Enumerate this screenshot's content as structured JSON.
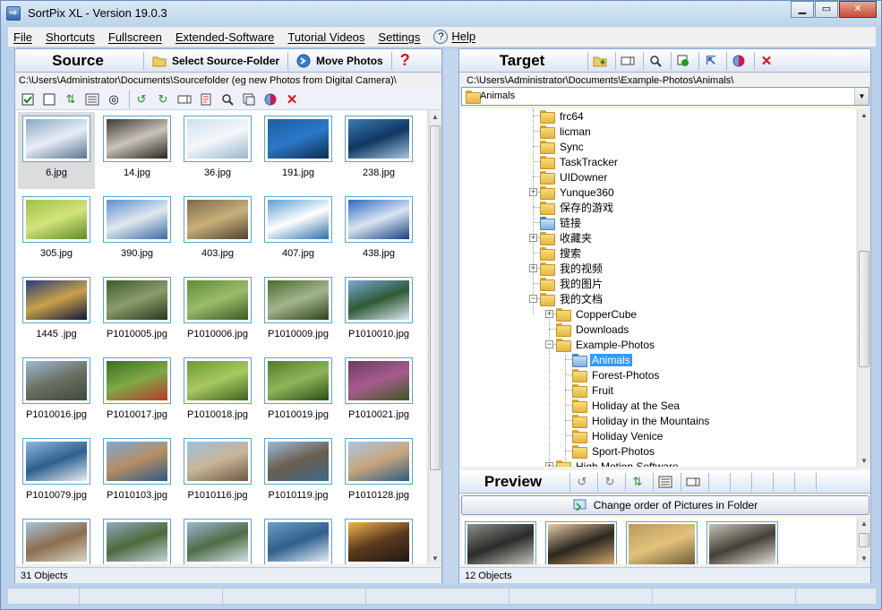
{
  "window": {
    "title": "SortPix XL - Version 19.0.3",
    "min": "▁",
    "max": "▭",
    "close": "✕"
  },
  "menu": [
    {
      "label": "File"
    },
    {
      "label": "Shortcuts"
    },
    {
      "label": "Fullscreen"
    },
    {
      "label": "Extended-Software"
    },
    {
      "label": "Tutorial Videos"
    },
    {
      "label": "Settings"
    },
    {
      "label": "Help",
      "icon": "help-icon"
    }
  ],
  "source": {
    "title": "Source",
    "select_folder": "Select Source-Folder",
    "move_photos": "Move Photos",
    "help_glyph": "?",
    "path": "C:\\Users\\Administrator\\Documents\\Sourcefolder (eg new Photos from Digital Camera)\\",
    "toolbar_icons": [
      "check-all-icon",
      "uncheck-all-icon",
      "sort-icon",
      "list-view-icon",
      "rotate-sound-icon",
      "rotate-left-icon",
      "rotate-right-icon",
      "rename-icon",
      "properties-icon",
      "search-icon",
      "copy-icon",
      "color-icon",
      "delete-icon"
    ],
    "thumbs": [
      {
        "name": "6.jpg",
        "colors": [
          "#8aa6c4",
          "#e9eef5",
          "#5a7390"
        ]
      },
      {
        "name": "14.jpg",
        "colors": [
          "#3d3a33",
          "#c9c3b8",
          "#262521"
        ]
      },
      {
        "name": "36.jpg",
        "colors": [
          "#cfe0ee",
          "#f5f7fa",
          "#9bb5cc"
        ]
      },
      {
        "name": "191.jpg",
        "colors": [
          "#1c5fa3",
          "#2b78c9",
          "#0d2c4f"
        ]
      },
      {
        "name": "238.jpg",
        "colors": [
          "#3c7ab0",
          "#0f3763",
          "#a7c6e0"
        ]
      },
      {
        "name": "305.jpg",
        "colors": [
          "#9cc24a",
          "#d3e47a",
          "#5f8a24"
        ]
      },
      {
        "name": "390.jpg",
        "colors": [
          "#5b8fcf",
          "#e0e8ef",
          "#3a6aa0"
        ]
      },
      {
        "name": "403.jpg",
        "colors": [
          "#7b6a4d",
          "#c8b079",
          "#4f4331"
        ]
      },
      {
        "name": "407.jpg",
        "colors": [
          "#5a9fd4",
          "#ffffff",
          "#2d6fa6"
        ]
      },
      {
        "name": "438.jpg",
        "colors": [
          "#2f69c4",
          "#d8e5f2",
          "#173f7d"
        ]
      },
      {
        "name": "1445 .jpg",
        "colors": [
          "#2a3a7a",
          "#c9a24a",
          "#0f163a"
        ]
      },
      {
        "name": "P1010005.jpg",
        "colors": [
          "#3e5c2a",
          "#8b9c6d",
          "#27381a"
        ]
      },
      {
        "name": "P1010006.jpg",
        "colors": [
          "#5f8c3a",
          "#9cbc6a",
          "#3b5a22"
        ]
      },
      {
        "name": "P1010009.jpg",
        "colors": [
          "#4b6c2e",
          "#a3b58d",
          "#2d4219"
        ]
      },
      {
        "name": "P1010010.jpg",
        "colors": [
          "#7aa7d6",
          "#2f5a35",
          "#dbe7f2"
        ]
      },
      {
        "name": "P1010016.jpg",
        "colors": [
          "#9fb9d4",
          "#6b6f62",
          "#3f4a3c"
        ]
      },
      {
        "name": "P1010017.jpg",
        "colors": [
          "#3d6e24",
          "#7fa847",
          "#b53a2a"
        ]
      },
      {
        "name": "P1010018.jpg",
        "colors": [
          "#6a9a34",
          "#a8c861",
          "#3d6420"
        ]
      },
      {
        "name": "P1010019.jpg",
        "colors": [
          "#4f7d2c",
          "#8fb55a",
          "#2c4d16"
        ]
      },
      {
        "name": "P1010021.jpg",
        "colors": [
          "#6b3d5e",
          "#a75b8e",
          "#3a5a22"
        ]
      },
      {
        "name": "P1010079.jpg",
        "colors": [
          "#8fb7dc",
          "#2d5f8f",
          "#e6eef5"
        ]
      },
      {
        "name": "P1010103.jpg",
        "colors": [
          "#7daad6",
          "#b58d62",
          "#2f5a87"
        ]
      },
      {
        "name": "P1010116.jpg",
        "colors": [
          "#9ec0e0",
          "#c7b598",
          "#6e5a45"
        ]
      },
      {
        "name": "P1010119.jpg",
        "colors": [
          "#9cbbd8",
          "#6a5e4e",
          "#3e6b88"
        ]
      },
      {
        "name": "P1010128.jpg",
        "colors": [
          "#a9c7e3",
          "#c6a57c",
          "#2e5c7e"
        ]
      },
      {
        "name": "",
        "colors": [
          "#a9c3dc",
          "#8c6e4f",
          "#d9d4c8"
        ]
      },
      {
        "name": "",
        "colors": [
          "#8fa9c0",
          "#4d6a3c",
          "#c5d3de"
        ]
      },
      {
        "name": "",
        "colors": [
          "#9ab6cf",
          "#4e6d45",
          "#d3dee8"
        ]
      },
      {
        "name": "",
        "colors": [
          "#6d9cc8",
          "#2f5f8e",
          "#e4edf5"
        ]
      },
      {
        "name": "",
        "colors": [
          "#f2b44a",
          "#5a3a1e",
          "#1e1a16"
        ]
      }
    ],
    "status": "31 Objects"
  },
  "target": {
    "title": "Target",
    "toolbar_icons": [
      "new-folder-icon",
      "rename-folder-icon",
      "search-icon",
      "refresh-icon",
      "back-icon",
      "color-icon",
      "delete-icon"
    ],
    "path": "C:\\Users\\Administrator\\Documents\\Example-Photos\\Animals\\",
    "combo_value": "Animals",
    "tree": [
      {
        "label": "frc64",
        "level": 5,
        "exp": ""
      },
      {
        "label": "licman",
        "level": 5,
        "exp": ""
      },
      {
        "label": "Sync",
        "level": 5,
        "exp": ""
      },
      {
        "label": "TaskTracker",
        "level": 5,
        "exp": ""
      },
      {
        "label": "UIDowner",
        "level": 5,
        "exp": ""
      },
      {
        "label": "Yunque360",
        "level": 5,
        "exp": "+"
      },
      {
        "label": "保存的游戏",
        "level": 5,
        "exp": ""
      },
      {
        "label": "链接",
        "level": 5,
        "exp": "",
        "blue": true
      },
      {
        "label": "收藏夹",
        "level": 5,
        "exp": "+"
      },
      {
        "label": "搜索",
        "level": 5,
        "exp": ""
      },
      {
        "label": "我的视频",
        "level": 5,
        "exp": "+"
      },
      {
        "label": "我的图片",
        "level": 5,
        "exp": ""
      },
      {
        "label": "我的文档",
        "level": 5,
        "exp": "-"
      },
      {
        "label": "CopperCube",
        "level": 6,
        "exp": "+"
      },
      {
        "label": "Downloads",
        "level": 6,
        "exp": ""
      },
      {
        "label": "Example-Photos",
        "level": 6,
        "exp": "-"
      },
      {
        "label": "Animals",
        "level": 7,
        "exp": "",
        "selected": true,
        "blue": true
      },
      {
        "label": "Forest-Photos",
        "level": 7,
        "exp": ""
      },
      {
        "label": "Fruit",
        "level": 7,
        "exp": ""
      },
      {
        "label": "Holiday at the Sea",
        "level": 7,
        "exp": ""
      },
      {
        "label": "Holiday in the Mountains",
        "level": 7,
        "exp": ""
      },
      {
        "label": "Holiday Venice",
        "level": 7,
        "exp": ""
      },
      {
        "label": "Sport-Photos",
        "level": 7,
        "exp": ""
      },
      {
        "label": "High Motion Software",
        "level": 6,
        "exp": "+"
      }
    ]
  },
  "preview": {
    "title": "Preview",
    "toolbar_icons": [
      "rotate-left-icon",
      "rotate-right-icon",
      "sort-icon",
      "list-view-icon",
      "rename-icon"
    ],
    "change_order": "Change order of Pictures in Folder",
    "thumbs": [
      {
        "colors": [
          "#8a8f86",
          "#2b2b2b",
          "#c9c7bd"
        ]
      },
      {
        "colors": [
          "#e6cba3",
          "#2a2620",
          "#d2a86e"
        ]
      },
      {
        "colors": [
          "#b99a5b",
          "#e2c27c",
          "#6d5a36"
        ]
      },
      {
        "colors": [
          "#c8c2b4",
          "#454037",
          "#e9e6de"
        ]
      }
    ],
    "status": "12 Objects"
  }
}
